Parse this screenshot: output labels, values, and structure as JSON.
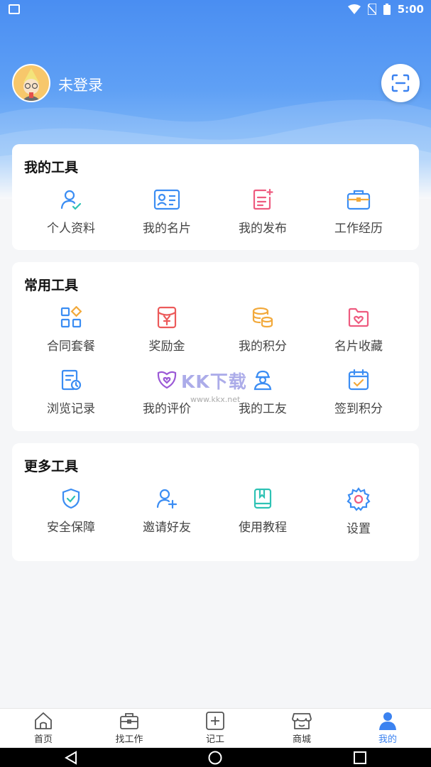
{
  "status_bar": {
    "time": "5:00"
  },
  "profile": {
    "login_status": "未登录"
  },
  "sections": {
    "my_tools": {
      "title": "我的工具",
      "items": [
        "个人资料",
        "我的名片",
        "我的发布",
        "工作经历"
      ]
    },
    "common_tools": {
      "title": "常用工具",
      "items": [
        "合同套餐",
        "奖励金",
        "我的积分",
        "名片收藏",
        "浏览记录",
        "我的评价",
        "我的工友",
        "签到积分"
      ]
    },
    "more_tools": {
      "title": "更多工具",
      "items": [
        "安全保障",
        "邀请好友",
        "使用教程",
        "设置"
      ]
    }
  },
  "watermark": {
    "text": "KK下载",
    "url": "www.kkx.net"
  },
  "tabs": [
    {
      "label": "首页",
      "icon": "home-icon"
    },
    {
      "label": "找工作",
      "icon": "briefcase-icon"
    },
    {
      "label": "记工",
      "icon": "plus-square-icon"
    },
    {
      "label": "商城",
      "icon": "store-icon"
    },
    {
      "label": "我的",
      "icon": "user-icon",
      "active": true
    }
  ],
  "colors": {
    "accent": "#3b82f0",
    "header_top": "#4a8ef2"
  }
}
